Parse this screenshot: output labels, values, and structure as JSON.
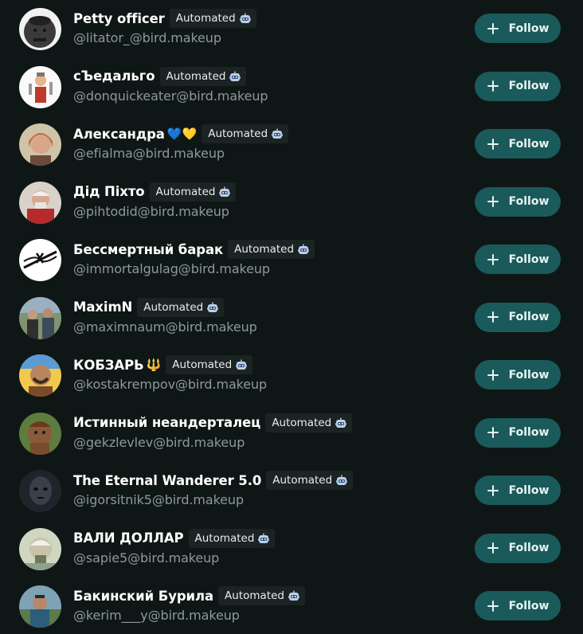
{
  "badge_label": "Automated",
  "follow_label": "Follow",
  "accounts": [
    {
      "name": "Petty officer",
      "emoji": "",
      "handle": "@litator_@bird.makeup",
      "avatar": "statue-avatar"
    },
    {
      "name": "сЪедальго",
      "emoji": "",
      "handle": "@donquickeater@bird.makeup",
      "avatar": "knight-avatar"
    },
    {
      "name": "Александра",
      "emoji": "💙💛",
      "handle": "@efialma@bird.makeup",
      "avatar": "woman-avatar"
    },
    {
      "name": "Дід Піхто",
      "emoji": "",
      "handle": "@pihtodid@bird.makeup",
      "avatar": "old-man-avatar"
    },
    {
      "name": "Бессмертный барак",
      "emoji": "",
      "handle": "@immortalgulag@bird.makeup",
      "avatar": "barbed-wire-avatar"
    },
    {
      "name": "MaximN",
      "emoji": "",
      "handle": "@maximnaum@bird.makeup",
      "avatar": "group-photo-avatar"
    },
    {
      "name": "КОБЗАРЬ",
      "emoji": "🔱",
      "handle": "@kostakrempov@bird.makeup",
      "avatar": "cossack-avatar"
    },
    {
      "name": "Истинный неандерталец",
      "emoji": "",
      "handle": "@gekzlevlev@bird.makeup",
      "avatar": "neanderthal-avatar"
    },
    {
      "name": "The Eternal Wanderer 5.0",
      "emoji": "",
      "handle": "@igorsitnik5@bird.makeup",
      "avatar": "robot-face-avatar"
    },
    {
      "name": "ВАЛИ ДОЛЛАР",
      "emoji": "",
      "handle": "@sapie5@bird.makeup",
      "avatar": "dollar-bill-avatar"
    },
    {
      "name": "Бакинский Бурила",
      "emoji": "",
      "handle": "@kerim___y@bird.makeup",
      "avatar": "man-outdoor-avatar"
    }
  ],
  "colors": {
    "background": "#0f1716",
    "button": "#1a5a5a",
    "handle": "#8b9a99",
    "badge_bg": "#1b2323"
  }
}
